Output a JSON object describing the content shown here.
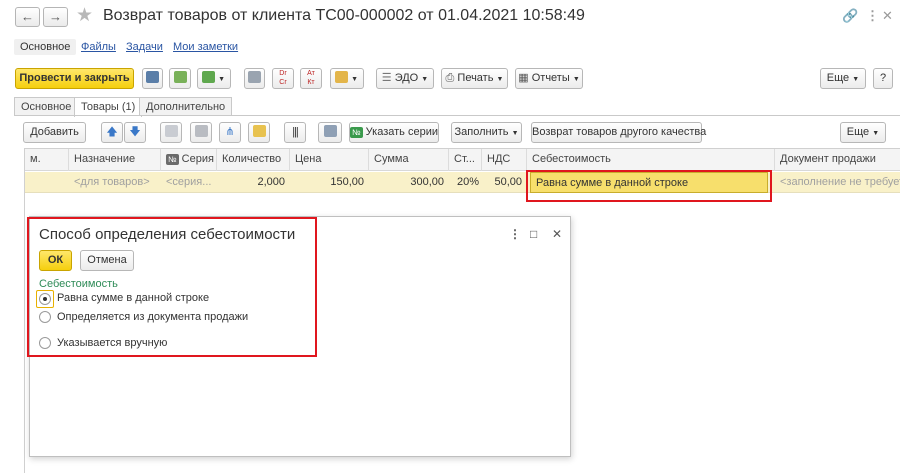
{
  "window": {
    "title": "Возврат товаров от клиента ТС00-000002 от 01.04.2021 10:58:49",
    "back_icon": "arrow-left-icon",
    "forward_icon": "arrow-right-icon",
    "favorite_icon": "star-icon",
    "controls": [
      "link-icon",
      "more-icon",
      "close-icon"
    ]
  },
  "section_nav": {
    "items": [
      "Основное",
      "Файлы",
      "Задачи",
      "Мои заметки"
    ]
  },
  "toolbar": {
    "post_and_close": "Провести и закрыть",
    "edo": "ЭДО",
    "print": "Печать",
    "reports": "Отчеты",
    "more": "Еще",
    "help": "?"
  },
  "tabs": [
    "Основное",
    "Товары (1)",
    "Дополнительно"
  ],
  "table_toolbar": {
    "add": "Добавить",
    "specify_series": "Указать серии",
    "fill": "Заполнить",
    "return_other_quality": "Возврат товаров другого качества",
    "more": "Еще"
  },
  "table": {
    "columns": [
      "м.",
      "Назначение",
      "Серия",
      "Количество",
      "Цена",
      "Сумма",
      "Ст...",
      "НДС",
      "Себестоимость",
      "Документ продажи"
    ],
    "series_badge": "№",
    "row": {
      "purpose": "<для товаров>",
      "series": "<серия...",
      "quantity": "2,000",
      "price": "150,00",
      "sum": "300,00",
      "rate": "20%",
      "vat": "50,00",
      "cost": "Равна сумме в данной строке",
      "sale_document": "<заполнение не требует"
    }
  },
  "dialog": {
    "title": "Способ определения себестоимости",
    "ok": "ОК",
    "cancel": "Отмена",
    "group_label": "Себестоимость",
    "options": [
      "Равна сумме в данной строке",
      "Определяется из документа продажи",
      "Указывается вручную"
    ],
    "selected_option": "Равна сумме в данной строке"
  },
  "colors": {
    "primary_button": "#f5cf0e",
    "highlight_row": "#f9f1c9",
    "selected_cell": "#f7df6c",
    "annotation_frame": "#e0161e",
    "link": "#2a55a3",
    "group_label": "#2e8b57"
  }
}
